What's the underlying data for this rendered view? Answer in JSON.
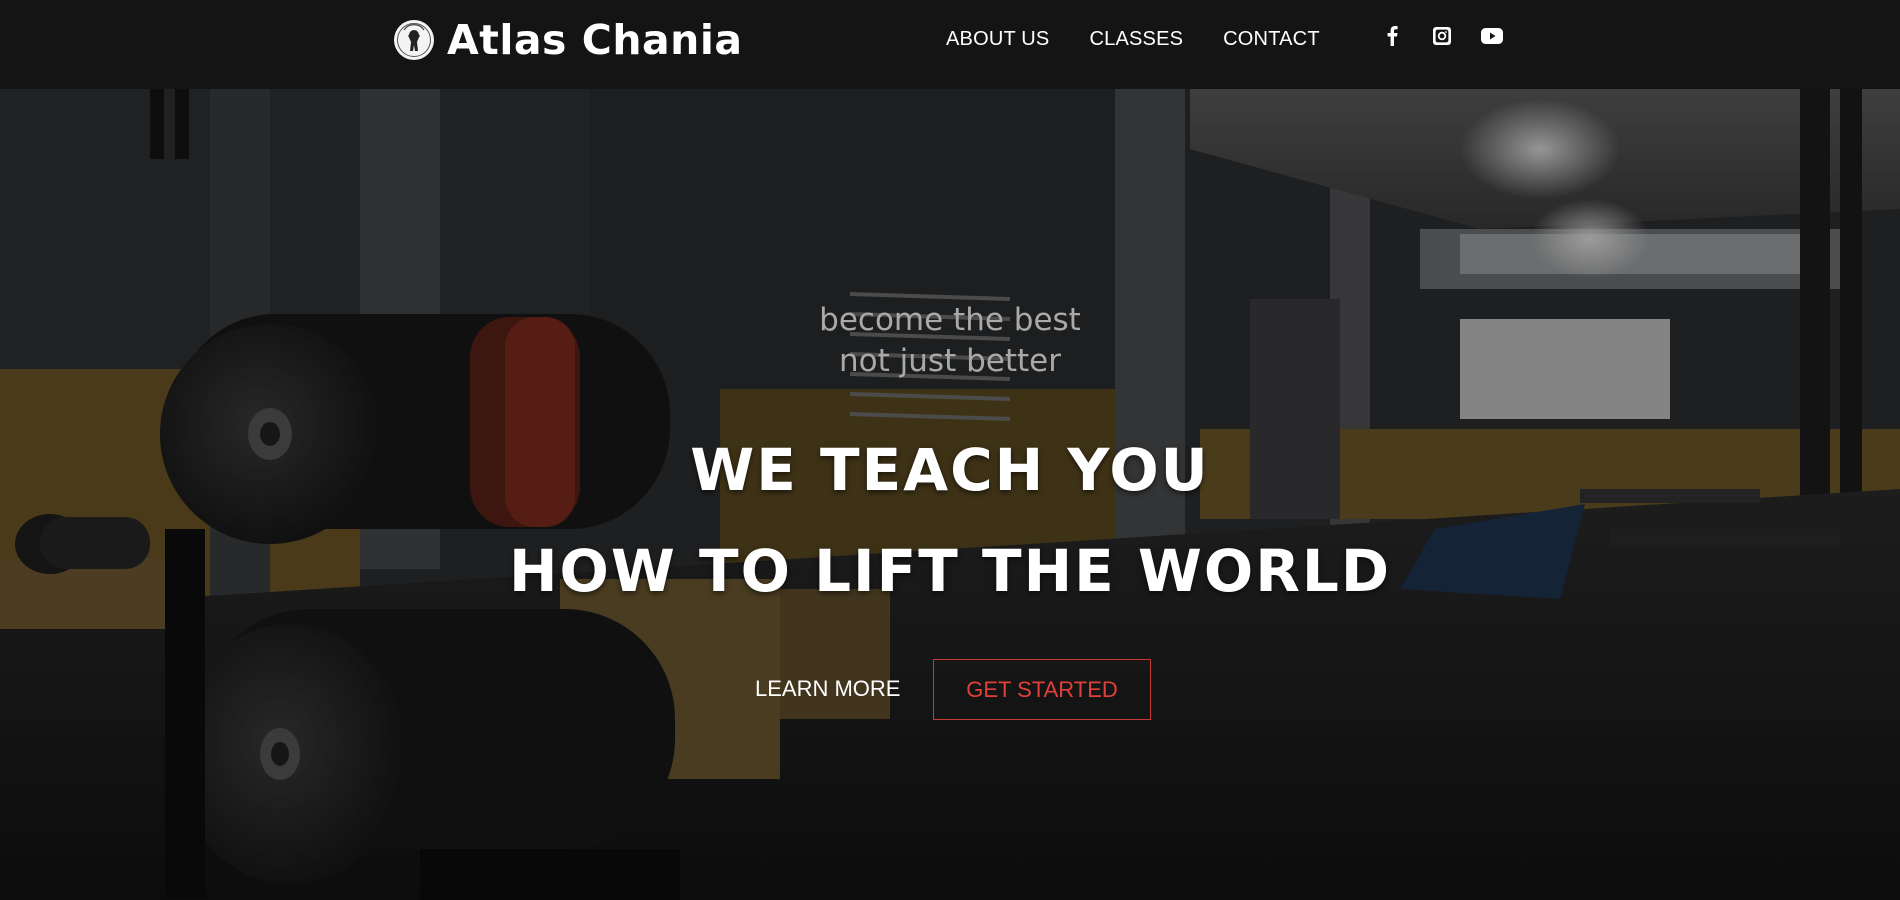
{
  "brand": {
    "name": "Atlas Chania"
  },
  "nav": {
    "items": [
      {
        "label": "ABOUT US"
      },
      {
        "label": "CLASSES"
      },
      {
        "label": "CONTACT"
      }
    ]
  },
  "social": {
    "icons": [
      "facebook-icon",
      "instagram-icon",
      "youtube-icon"
    ]
  },
  "hero": {
    "tagline_line1": "become the best",
    "tagline_line2": "not just better",
    "headline_line1": "WE TEACH YOU",
    "headline_line2": "HOW TO LIFT THE WORLD",
    "learn_more_label": "LEARN MORE",
    "get_started_label": "GET STARTED"
  },
  "colors": {
    "header_bg": "#141414",
    "accent_red": "#e0403b",
    "text_white": "#ffffff",
    "tagline_gray": "#a9a9a9"
  }
}
